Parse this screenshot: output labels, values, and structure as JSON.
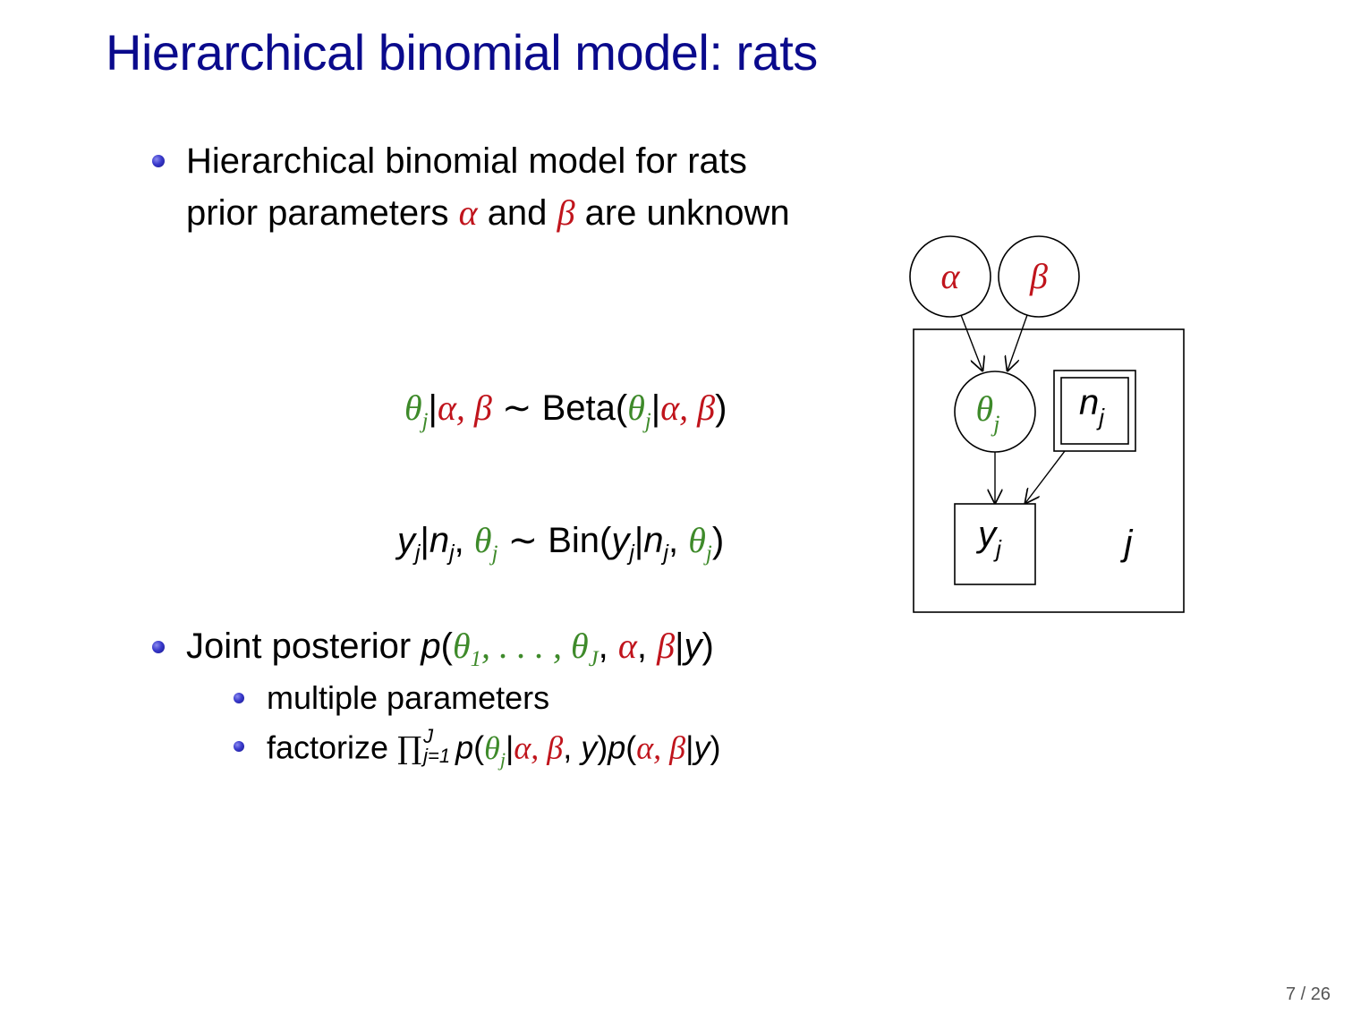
{
  "slide": {
    "title": "Hierarchical binomial model: rats",
    "bullet1": {
      "line1": "Hierarchical binomial model for rats",
      "line2_prefix": "prior parameters",
      "alpha": "α",
      "and": "and",
      "beta": "β",
      "line2_suffix": "are unknown"
    },
    "equations": {
      "eq1": {
        "lhs": "θ",
        "sub": "j",
        "cond": "α, β",
        "dist": "Beta"
      },
      "eq2": {
        "lhs": "y",
        "sub": "j",
        "n": "n",
        "theta": "θ",
        "dist": "Bin"
      }
    },
    "bullet2": {
      "text": "Joint posterior",
      "sub1": "multiple parameters",
      "sub2": "factorize",
      "prod_upper": "J",
      "prod_lower": "j=1"
    },
    "diagram": {
      "node_alpha": "α",
      "node_beta": "β",
      "node_theta": "θ",
      "node_n": "n",
      "node_y": "y",
      "subscript": "j",
      "plate_label": "j"
    },
    "page_number": "7 / 26",
    "colors": {
      "title": "#0a0a8c",
      "red": "#c0141c",
      "green": "#3e8a2a"
    }
  }
}
